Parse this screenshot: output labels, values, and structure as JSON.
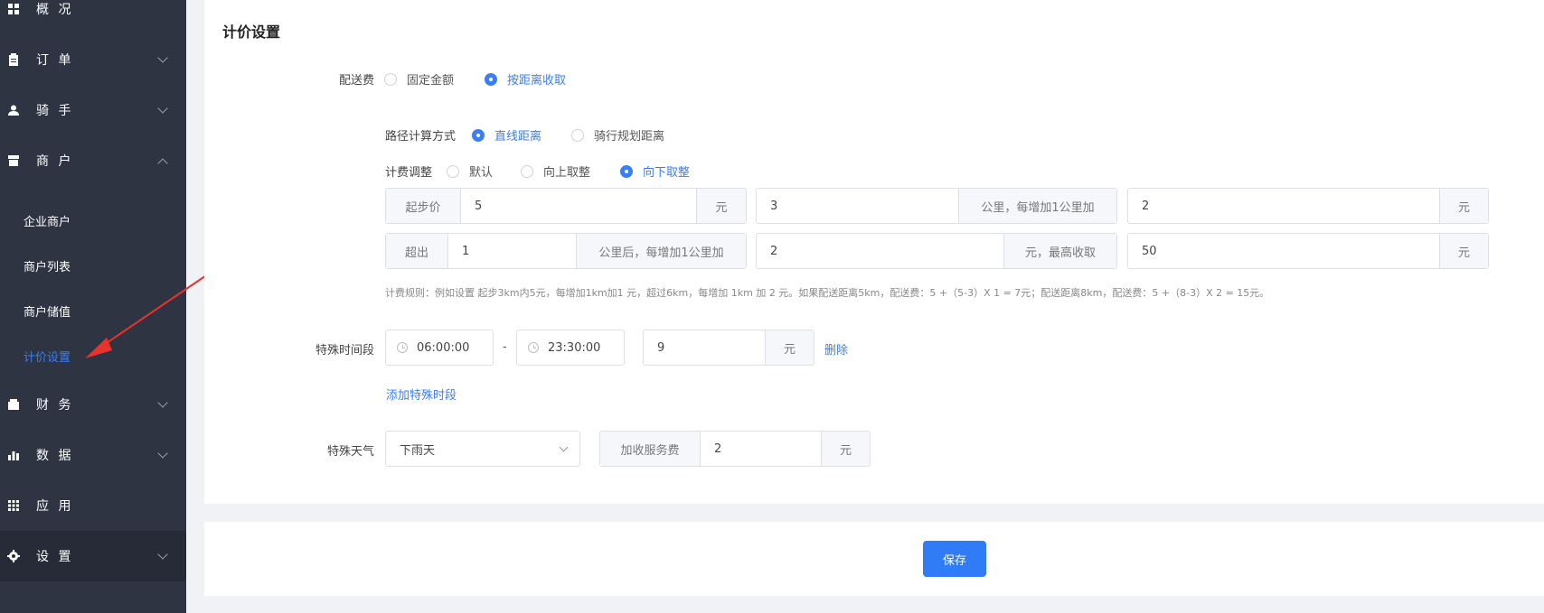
{
  "colors": {
    "sidebar_bg": "#2e3442",
    "accent": "#3a7ef8",
    "annotation_arrow": "#e8322b"
  },
  "sidebar": {
    "items": [
      {
        "label": "概 况",
        "icon": "grid-icon"
      },
      {
        "label": "订 单",
        "icon": "clipboard-icon"
      },
      {
        "label": "骑 手",
        "icon": "user-icon"
      },
      {
        "label": "商 户",
        "icon": "shop-icon"
      },
      {
        "label": "财 务",
        "icon": "wallet-icon"
      },
      {
        "label": "数 据",
        "icon": "bar-chart-icon"
      },
      {
        "label": "应 用",
        "icon": "apps-icon"
      },
      {
        "label": "设 置",
        "icon": "gear-icon"
      }
    ],
    "merchant_sub": [
      "企业商户",
      "商户列表",
      "商户储值",
      "计价设置"
    ]
  },
  "main": {
    "title": "计价设置",
    "delivery_fee": {
      "label": "配送费",
      "options": [
        "固定金额",
        "按距离收取"
      ],
      "selected": "按距离收取"
    },
    "route_calc": {
      "label": "路径计算方式",
      "options": [
        "直线距离",
        "骑行规划距离"
      ],
      "selected": "直线距离"
    },
    "fee_adjust": {
      "label": "计费调整",
      "options": [
        "默认",
        "向上取整",
        "向下取整"
      ],
      "selected": "向下取整"
    },
    "row1": {
      "start_label": "起步价",
      "start_value": "5",
      "unit1": "元",
      "km_value": "3",
      "km_addon": "公里，每增加1公里加",
      "add_value": "2",
      "unit2": "元"
    },
    "row2": {
      "exceed_label": "超出",
      "exceed_value": "1",
      "exceed_addon": "公里后，每增加1公里加",
      "add_value": "2",
      "max_addon": "元，最高收取",
      "max_value": "50",
      "unit": "元"
    },
    "hint": "计费规则：例如设置 起步3km内5元，每增加1km加1 元，超过6km，每增加 1km 加 2 元。如果配送距离5km，配送费：5 +（5-3）X 1 = 7元；配送距离8km，配送费：5 +（8-3）X 2 = 15元。",
    "special_time": {
      "label": "特殊时间段",
      "start": "06:00:00",
      "dash": "-",
      "end": "23:30:00",
      "fee": "9",
      "unit": "元",
      "delete": "删除",
      "add_link": "添加特殊时段"
    },
    "special_weather": {
      "label": "特殊天气",
      "selected": "下雨天",
      "surcharge_label": "加收服务费",
      "surcharge_value": "2",
      "unit": "元"
    },
    "save_label": "保存"
  }
}
